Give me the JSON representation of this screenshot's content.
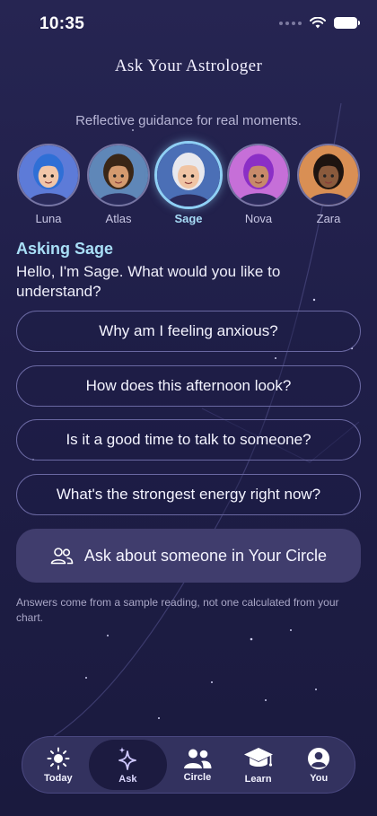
{
  "status_bar": {
    "time": "10:35"
  },
  "header": {
    "title": "Ask Your Astrologer",
    "subtitle": "Reflective guidance for real moments."
  },
  "astrologers": [
    {
      "name": "Luna",
      "selected": false,
      "hair": "#2f6fd6",
      "skin": "#f2c6a8",
      "bg": "#5d7bd8"
    },
    {
      "name": "Atlas",
      "selected": false,
      "hair": "#3a2616",
      "skin": "#d49a6e",
      "bg": "#5f87b8"
    },
    {
      "name": "Sage",
      "selected": true,
      "hair": "#e8e8ee",
      "skin": "#f0c4a4",
      "bg": "#4b6fb6"
    },
    {
      "name": "Nova",
      "selected": false,
      "hair": "#8b2fc6",
      "skin": "#c78a6a",
      "bg": "#c66fd8"
    },
    {
      "name": "Zara",
      "selected": false,
      "hair": "#1e1410",
      "skin": "#8a5a3c",
      "bg": "#d98f54"
    }
  ],
  "asking": {
    "label": "Asking Sage",
    "greeting": "Hello, I'm Sage. What would you like to understand?"
  },
  "questions": [
    "Why am I feeling anxious?",
    "How does this afternoon look?",
    "Is it a good time to talk to someone?",
    "What's the strongest energy right now?"
  ],
  "circle_button": {
    "label": "Ask about someone in Your Circle",
    "icon": "people-icon"
  },
  "disclaimer": "Answers come from a sample reading, not one calculated from your chart.",
  "tabs": [
    {
      "label": "Today",
      "icon": "sun-icon",
      "active": false
    },
    {
      "label": "Ask",
      "icon": "sparkles-icon",
      "active": true
    },
    {
      "label": "Circle",
      "icon": "people-icon",
      "active": false
    },
    {
      "label": "Learn",
      "icon": "graduation-cap-icon",
      "active": false
    },
    {
      "label": "You",
      "icon": "profile-icon",
      "active": false
    }
  ],
  "colors": {
    "background": "#1f1e48",
    "accent": "#a9dff7",
    "button_border": "#6a68a2",
    "circle_button": "#403d6d",
    "tabbar": "#33325f"
  }
}
